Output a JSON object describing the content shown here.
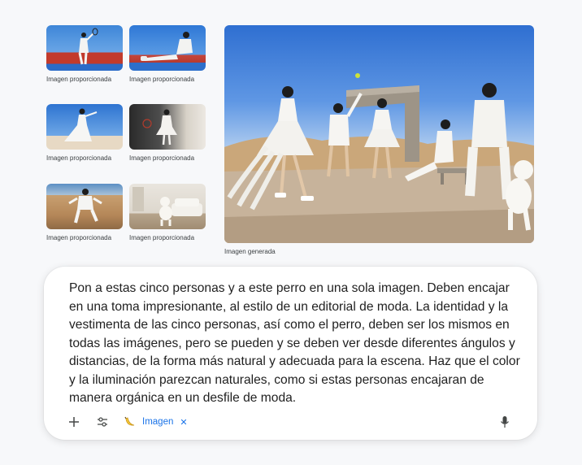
{
  "inputs": {
    "thumbnails": [
      {
        "caption": "Imagen proporcionada"
      },
      {
        "caption": "Imagen proporcionada"
      },
      {
        "caption": "Imagen proporcionada"
      },
      {
        "caption": "Imagen proporcionada"
      },
      {
        "caption": "Imagen proporcionada"
      },
      {
        "caption": "Imagen proporcionada"
      }
    ]
  },
  "output": {
    "caption": "Imagen generada"
  },
  "prompt": {
    "text": "Pon a estas cinco personas y a este perro en una sola imagen. Deben encajar en una toma impresionante, al estilo de un editorial de moda. La identidad y la vestimenta de las cinco personas, así como el perro, deben ser los mismos en todas las imágenes, pero se pueden y se deben ver desde diferentes ángulos y distancias, de la forma más natural y adecuada para la escena. Haz que el color y la iluminación parezcan naturales, como si estas personas encajaran de manera orgánica en un desfile de moda."
  },
  "toolbar": {
    "add_icon": "plus-icon",
    "tools_icon": "sliders-icon",
    "chip": {
      "icon": "banana-icon",
      "label": "Imagen",
      "close_icon": "close-icon"
    },
    "mic_icon": "microphone-icon"
  },
  "colors": {
    "accent": "#1a73e8",
    "background": "#f7f8fa",
    "card": "#ffffff"
  }
}
